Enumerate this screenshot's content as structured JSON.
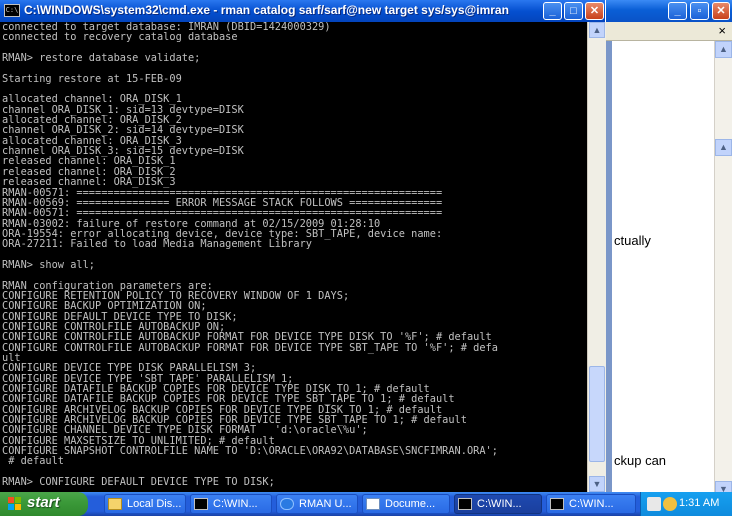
{
  "cmd_window": {
    "title": "C:\\WINDOWS\\system32\\cmd.exe - rman catalog sarf/sarf@new target sys/sys@imran",
    "icon": "console-icon",
    "buttons": [
      "minimize",
      "maximize",
      "close"
    ],
    "console_lines": [
      "connected to target database: IMRAN (DBID=1424000329)",
      "connected to recovery catalog database",
      "",
      "RMAN> restore database validate;",
      "",
      "Starting restore at 15-FEB-09",
      "",
      "allocated channel: ORA_DISK_1",
      "channel ORA_DISK_1: sid=13 devtype=DISK",
      "allocated channel: ORA_DISK_2",
      "channel ORA_DISK_2: sid=14 devtype=DISK",
      "allocated channel: ORA_DISK_3",
      "channel ORA_DISK_3: sid=15 devtype=DISK",
      "released channel: ORA_DISK_1",
      "released channel: ORA_DISK_2",
      "released channel: ORA_DISK_3",
      "RMAN-00571: ===========================================================",
      "RMAN-00569: =============== ERROR MESSAGE STACK FOLLOWS ===============",
      "RMAN-00571: ===========================================================",
      "RMAN-03002: failure of restore command at 02/15/2009 01:28:10",
      "ORA-19554: error allocating device, device type: SBT_TAPE, device name:",
      "ORA-27211: Failed to load Media Management Library",
      "",
      "RMAN> show all;",
      "",
      "RMAN configuration parameters are:",
      "CONFIGURE RETENTION POLICY TO RECOVERY WINDOW OF 1 DAYS;",
      "CONFIGURE BACKUP OPTIMIZATION ON;",
      "CONFIGURE DEFAULT DEVICE TYPE TO DISK;",
      "CONFIGURE CONTROLFILE AUTOBACKUP ON;",
      "CONFIGURE CONTROLFILE AUTOBACKUP FORMAT FOR DEVICE TYPE DISK TO '%F'; # default",
      "CONFIGURE CONTROLFILE AUTOBACKUP FORMAT FOR DEVICE TYPE SBT_TAPE TO '%F'; # defa",
      "ult",
      "CONFIGURE DEVICE TYPE DISK PARALLELISM 3;",
      "CONFIGURE DEVICE TYPE 'SBT_TAPE' PARALLELISM 1;",
      "CONFIGURE DATAFILE BACKUP COPIES FOR DEVICE TYPE DISK TO 1; # default",
      "CONFIGURE DATAFILE BACKUP COPIES FOR DEVICE TYPE SBT_TAPE TO 1; # default",
      "CONFIGURE ARCHIVELOG BACKUP COPIES FOR DEVICE TYPE DISK TO 1; # default",
      "CONFIGURE ARCHIVELOG BACKUP COPIES FOR DEVICE TYPE SBT_TAPE TO 1; # default",
      "CONFIGURE CHANNEL DEVICE TYPE DISK FORMAT   'd:\\oracle\\%u';",
      "CONFIGURE MAXSETSIZE TO UNLIMITED; # default",
      "CONFIGURE SNAPSHOT CONTROLFILE NAME TO 'D:\\ORACLE\\ORA92\\DATABASE\\SNCFIMRAN.ORA';",
      " # default",
      "",
      "RMAN> CONFIGURE DEFAULT DEVICE TYPE TO DISK;"
    ]
  },
  "background_window": {
    "text_fragment_1": "ctually",
    "text_fragment_2": "ckup can",
    "menubar_close": "×"
  },
  "taskbar": {
    "start_label": "start",
    "tasks": [
      {
        "label": "Local Dis...",
        "icon": "folder-icon"
      },
      {
        "label": "C:\\WIN...",
        "icon": "console-icon"
      },
      {
        "label": "RMAN U...",
        "icon": "browser-icon"
      },
      {
        "label": "Docume...",
        "icon": "document-icon"
      },
      {
        "label": "C:\\WIN...",
        "icon": "console-icon"
      },
      {
        "label": "C:\\WIN...",
        "icon": "console-icon"
      }
    ],
    "clock": "1:31 AM"
  },
  "colors": {
    "console_bg": "#000000",
    "console_fg": "#c0c0c0",
    "title_bar": "#0550d0",
    "taskbar": "#245edb",
    "start_button": "#3c9a3a"
  }
}
